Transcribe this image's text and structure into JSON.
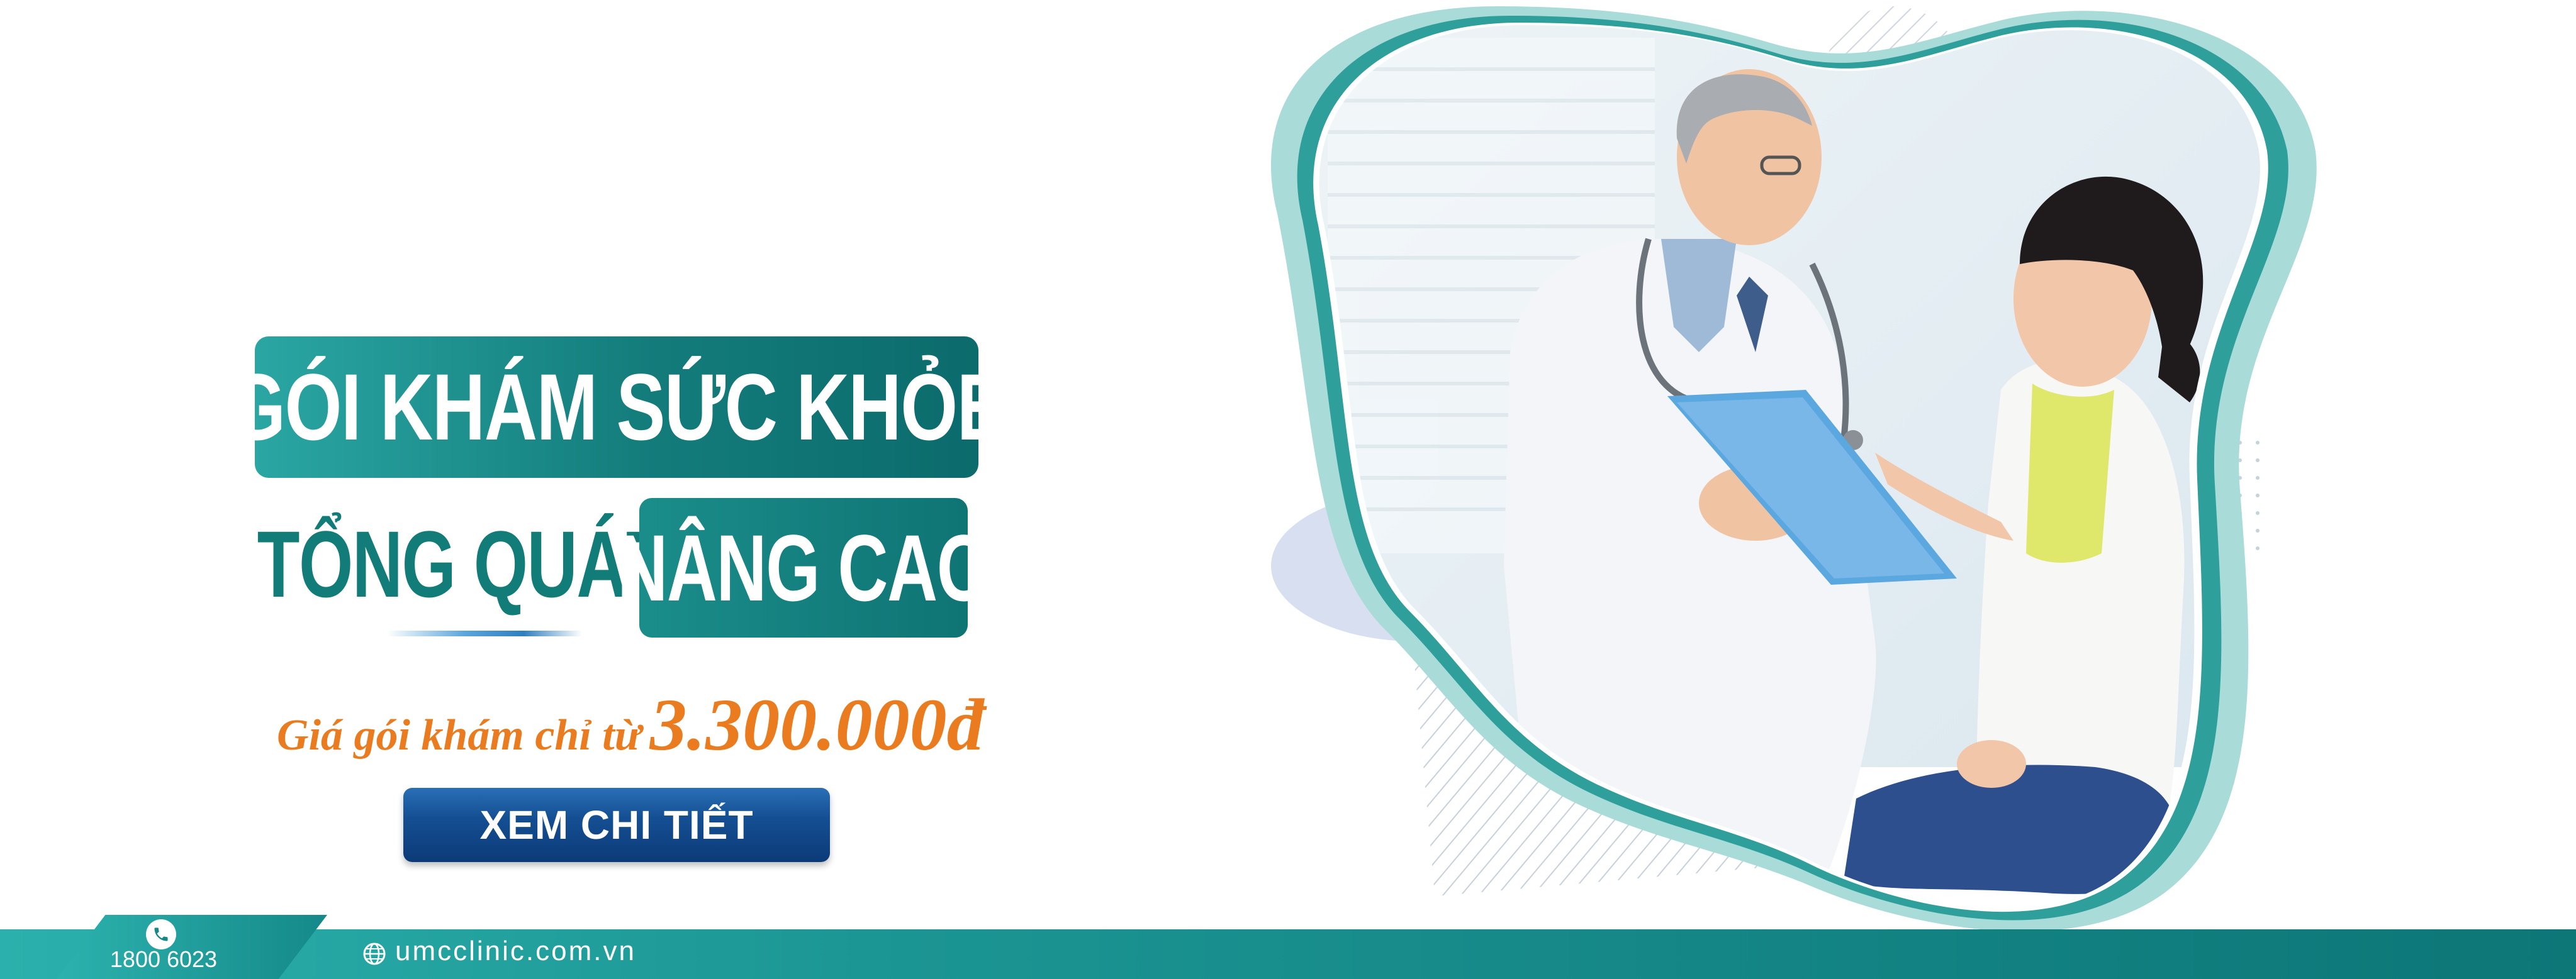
{
  "headline": {
    "line1": "GÓI KHÁM SỨC KHỎE",
    "line2_left": "TỔNG QUÁT",
    "line2_highlight": "NÂNG CAO"
  },
  "price": {
    "label": "Giá gói khám chỉ từ",
    "value": "3.300.000đ"
  },
  "cta": {
    "label": "XEM CHI TIẾT"
  },
  "footer": {
    "phone": "1800 6023",
    "website": "umcclinic.com.vn",
    "phone_icon": "phone-icon",
    "website_icon": "globe-icon"
  },
  "photo": {
    "description_icon": "doctor-patient-photo"
  },
  "colors": {
    "teal_primary": "#127c79",
    "teal_light": "#2aa6a3",
    "price_orange": "#ea7b1e",
    "cta_blue": "#144f93"
  }
}
